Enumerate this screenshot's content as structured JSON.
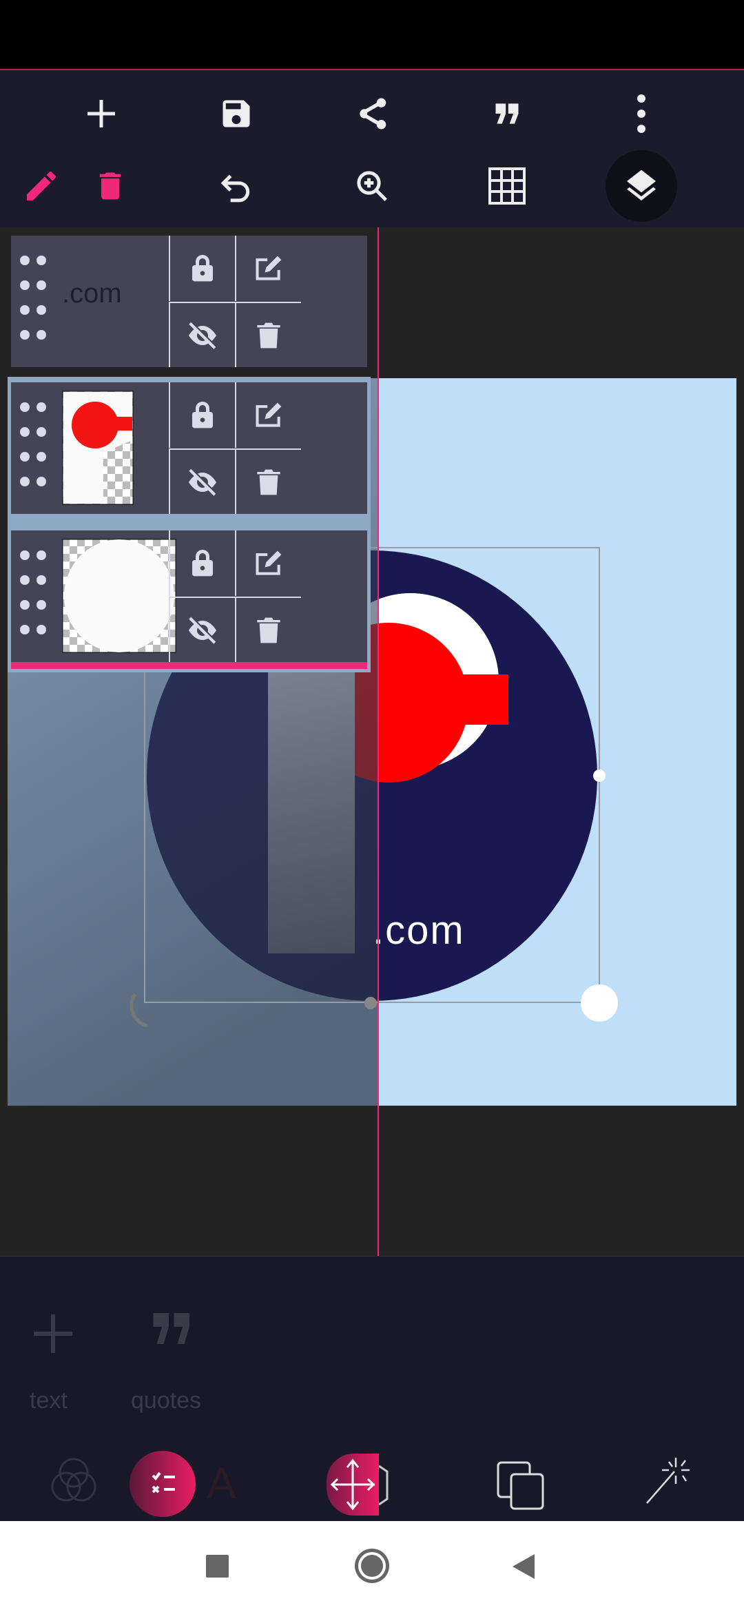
{
  "toolbar": {
    "row1": [
      "add-icon",
      "save-icon",
      "share-icon",
      "quote-icon",
      "more-vert-icon"
    ],
    "row2": [
      "pencil-icon",
      "trash-icon",
      "undo-icon",
      "zoom-in-icon",
      "grid-icon",
      "layers-icon"
    ]
  },
  "canvas": {
    "text": ".com",
    "colors": {
      "background": "#bfdff8",
      "circle": "#1a1850",
      "red": "#ff0000",
      "accent": "#e91e63"
    }
  },
  "layers": [
    {
      "name": ".com",
      "type": "text"
    },
    {
      "type": "image"
    },
    {
      "type": "image"
    }
  ],
  "bottom": {
    "items": [
      {
        "label": "text",
        "icon": "add-icon"
      },
      {
        "label": "quotes",
        "icon": "quote-icon"
      }
    ],
    "tools": [
      "blend-icon",
      "checklist-icon",
      "text-style-icon",
      "move-icon",
      "sticker-icon",
      "copy-icon",
      "magic-wand-icon"
    ]
  },
  "nav": [
    "recents",
    "home",
    "back"
  ]
}
